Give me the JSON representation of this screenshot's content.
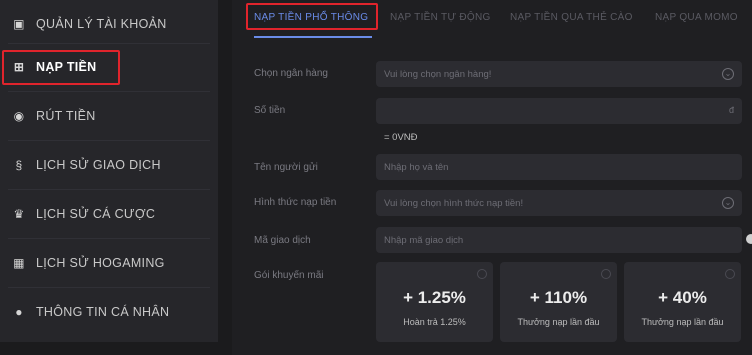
{
  "sidebar": {
    "items": [
      {
        "label": "QUẢN LÝ TÀI KHOẢN",
        "icon": "user-card-icon",
        "glyph": "▣"
      },
      {
        "label": "NẠP TIỀN",
        "icon": "deposit-icon",
        "glyph": "⊞"
      },
      {
        "label": "RÚT TIỀN",
        "icon": "withdraw-icon",
        "glyph": "◉"
      },
      {
        "label": "LỊCH SỬ GIAO DỊCH",
        "icon": "transaction-history-icon",
        "glyph": "§"
      },
      {
        "label": "LỊCH SỬ CÁ CƯỢC",
        "icon": "bet-history-icon",
        "glyph": "♛"
      },
      {
        "label": "LỊCH SỬ HOGAMING",
        "icon": "hogaming-history-icon",
        "glyph": "▦"
      },
      {
        "label": "THÔNG TIN CÁ NHÂN",
        "icon": "profile-info-icon",
        "glyph": "●"
      }
    ]
  },
  "tabs": [
    "NẠP TIỀN PHỔ THÔNG",
    "NẠP TIỀN TỰ ĐỘNG",
    "NẠP TIỀN QUA THẺ CÀO",
    "NẠP QUA MOMO"
  ],
  "form": {
    "bank_label": "Chọn ngân hàng",
    "bank_placeholder": "Vui lòng chọn ngân hàng!",
    "amount_label": "Số tiền",
    "amount_unit": "đ",
    "amount_conversion": "= 0VNĐ",
    "sender_label": "Tên người gửi",
    "sender_placeholder": "Nhập họ và tên",
    "method_label": "Hình thức nạp tiền",
    "method_placeholder": "Vui lòng chọn hình thức nạp tiền!",
    "txn_label": "Mã giao dịch",
    "txn_placeholder": "Nhập mã giao dịch",
    "promo_label": "Gói khuyến mãi"
  },
  "promos": [
    {
      "percent": "+ 1.25%",
      "desc": "Hoàn trả 1.25%"
    },
    {
      "percent": "+ 110%",
      "desc": "Thưởng nạp lần đầu"
    },
    {
      "percent": "+ 40%",
      "desc": "Thưởng nạp lần đầu"
    }
  ],
  "colors": {
    "accent": "#6a8be8",
    "highlight": "#e0242c",
    "sidebar_bg": "#26262a",
    "panel_bg": "#1f1f22"
  }
}
